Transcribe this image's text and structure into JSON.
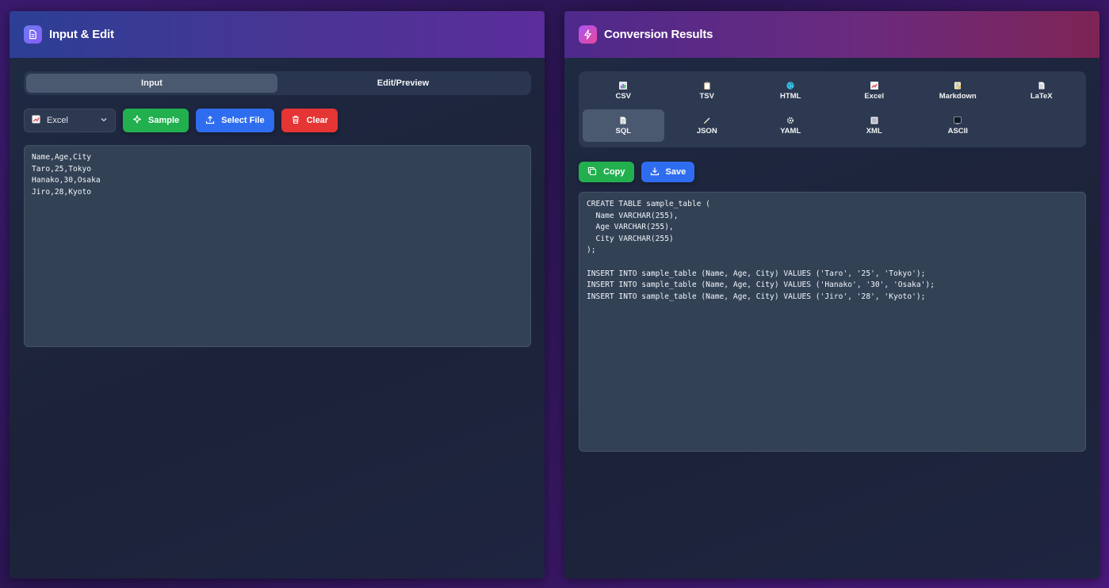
{
  "input_panel": {
    "title": "Input & Edit",
    "tabs": [
      {
        "label": "Input",
        "active": true
      },
      {
        "label": "Edit/Preview",
        "active": false
      }
    ],
    "format_select": {
      "value": "Excel"
    },
    "buttons": {
      "sample": "Sample",
      "select_file": "Select File",
      "clear": "Clear"
    },
    "input_text": "Name,Age,City\nTaro,25,Tokyo\nHanako,30,Osaka\nJiro,28,Kyoto"
  },
  "results_panel": {
    "title": "Conversion Results",
    "formats": [
      {
        "label": "CSV",
        "icon": "bar-chart-icon",
        "active": false
      },
      {
        "label": "TSV",
        "icon": "clipboard-icon",
        "active": false
      },
      {
        "label": "HTML",
        "icon": "globe-icon",
        "active": false
      },
      {
        "label": "Excel",
        "icon": "chart-up-icon",
        "active": false
      },
      {
        "label": "Markdown",
        "icon": "memo-icon",
        "active": false
      },
      {
        "label": "LaTeX",
        "icon": "page-icon",
        "active": false
      },
      {
        "label": "SQL",
        "icon": "page-icon",
        "active": true
      },
      {
        "label": "JSON",
        "icon": "pencil-icon",
        "active": false
      },
      {
        "label": "YAML",
        "icon": "gear-icon",
        "active": false
      },
      {
        "label": "XML",
        "icon": "document-icon",
        "active": false
      },
      {
        "label": "ASCII",
        "icon": "terminal-icon",
        "active": false
      }
    ],
    "buttons": {
      "copy": "Copy",
      "save": "Save"
    },
    "output_text": "CREATE TABLE sample_table (\n  Name VARCHAR(255),\n  Age VARCHAR(255),\n  City VARCHAR(255)\n);\n\nINSERT INTO sample_table (Name, Age, City) VALUES ('Taro', '25', 'Tokyo');\nINSERT INTO sample_table (Name, Age, City) VALUES ('Hanako', '30', 'Osaka');\nINSERT INTO sample_table (Name, Age, City) VALUES ('Jiro', '28', 'Kyoto');"
  },
  "colors": {
    "green": "#22b04f",
    "blue": "#2f6df0",
    "red": "#e53535",
    "editor_bg": "#334155"
  }
}
